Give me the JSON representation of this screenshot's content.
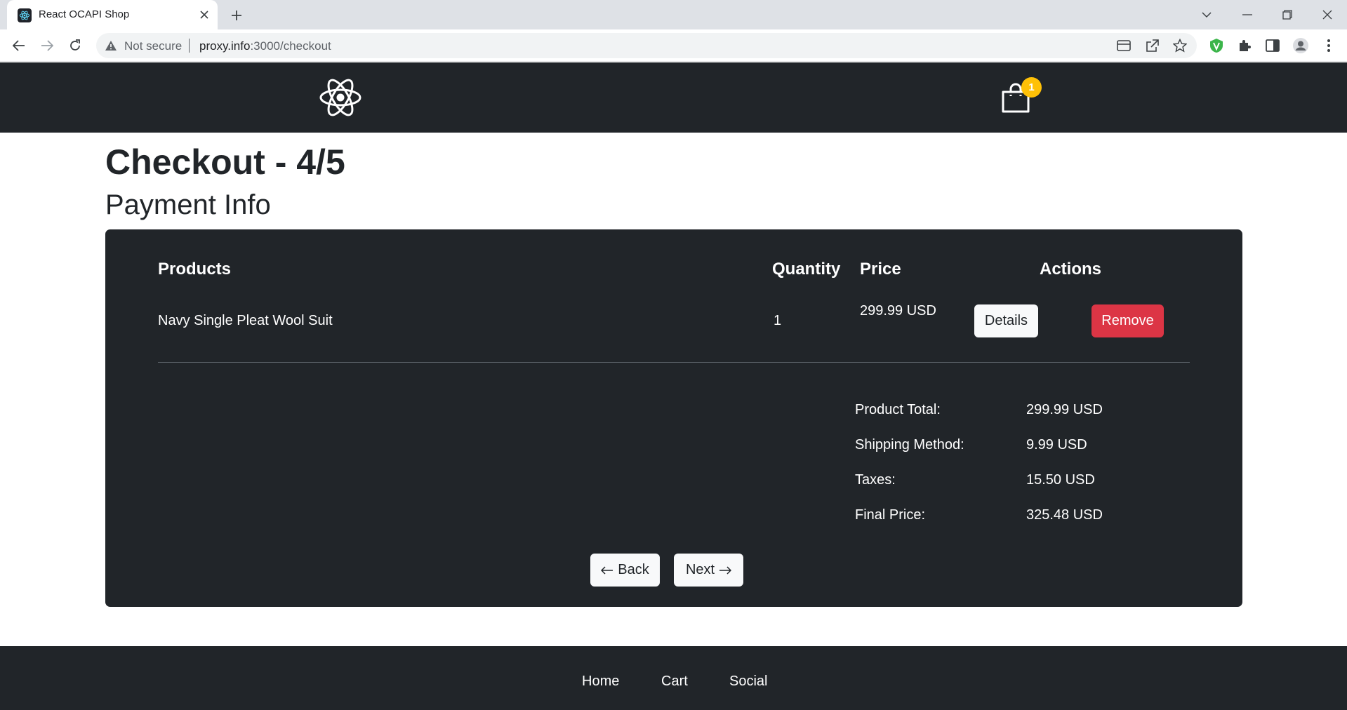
{
  "browser": {
    "tab_title": "React OCAPI Shop",
    "security_label": "Not secure",
    "url_host": "proxy.info",
    "url_rest": ":3000/checkout"
  },
  "header": {
    "cart_count": "1"
  },
  "page": {
    "title": "Checkout - 4/5",
    "section": "Payment Info"
  },
  "table": {
    "headers": {
      "products": "Products",
      "quantity": "Quantity",
      "price": "Price",
      "actions": "Actions"
    },
    "rows": [
      {
        "product": "Navy Single Pleat Wool Suit",
        "quantity": "1",
        "price": "299.99 USD",
        "details_label": "Details",
        "remove_label": "Remove"
      }
    ]
  },
  "summary": {
    "product_total_label": "Product Total:",
    "product_total_value": "299.99 USD",
    "shipping_label": "Shipping Method:",
    "shipping_value": "9.99 USD",
    "taxes_label": "Taxes:",
    "taxes_value": "15.50 USD",
    "final_label": "Final Price:",
    "final_value": "325.48 USD"
  },
  "navigation": {
    "back_label": "Back",
    "next_label": "Next"
  },
  "footer": {
    "links": [
      "Home",
      "Cart",
      "Social"
    ]
  },
  "colors": {
    "dark": "#212529",
    "danger": "#dc3545",
    "light": "#f8f9fa",
    "badge": "#ffc107"
  }
}
